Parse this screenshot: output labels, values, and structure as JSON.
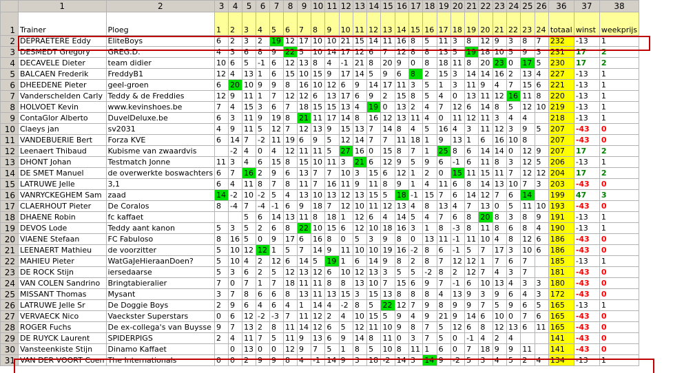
{
  "columns": [
    "1",
    "2",
    "3",
    "4",
    "5",
    "6",
    "7",
    "8",
    "9",
    "10",
    "11",
    "12",
    "13",
    "14",
    "15",
    "16",
    "17",
    "18",
    "19",
    "20",
    "21",
    "22",
    "23",
    "24",
    "25",
    "26",
    "36",
    "37",
    "38"
  ],
  "titles": [
    "Trainer",
    "Ploeg",
    "1",
    "2",
    "3",
    "4",
    "5",
    "6",
    "7",
    "8",
    "9",
    "10",
    "11",
    "12",
    "13",
    "14",
    "15",
    "16",
    "17",
    "18",
    "19",
    "20",
    "21",
    "22",
    "23",
    "24",
    "totaal",
    "winst",
    "weekprijs"
  ],
  "rows": [
    {
      "n": "2",
      "trainer": "DEPRAETERE Eddy",
      "ploeg": "EliteBoys",
      "s": [
        "6",
        "2",
        "3",
        "2",
        "19",
        "12",
        "17",
        "10",
        "10",
        "21",
        "15",
        "14",
        "11",
        "16",
        "8",
        "5",
        "11",
        "3",
        "8",
        "12",
        "9",
        "3",
        "8",
        "7"
      ],
      "hl": [
        4
      ],
      "totaal": "232",
      "winst": "-13",
      "week": "1"
    },
    {
      "n": "3",
      "trainer": "DESMEDT Gregory",
      "ploeg": "GREG.D.",
      "s": [
        "4",
        "3",
        "6",
        "8",
        "9",
        "22",
        "5",
        "10",
        "14",
        "17",
        "12",
        "6",
        "7",
        "12",
        "8",
        "8",
        "13",
        "5",
        "19",
        "18",
        "10",
        "5",
        "9",
        "3"
      ],
      "hl": [
        5,
        18
      ],
      "totaal": "231",
      "winst": "17",
      "week": "2"
    },
    {
      "n": "4",
      "trainer": "DECAVELE Dieter",
      "ploeg": "team didier",
      "s": [
        "10",
        "6",
        "5",
        "-1",
        "6",
        "12",
        "13",
        "8",
        "4",
        "-1",
        "21",
        "8",
        "20",
        "9",
        "0",
        "8",
        "18",
        "11",
        "8",
        "20",
        "23",
        "0",
        "17",
        "5"
      ],
      "hl": [
        20,
        22
      ],
      "totaal": "230",
      "winst": "17",
      "week": "2"
    },
    {
      "n": "5",
      "trainer": "BALCAEN Frederik",
      "ploeg": "FreddyB1",
      "s": [
        "12",
        "4",
        "13",
        "1",
        "6",
        "15",
        "10",
        "15",
        "9",
        "17",
        "14",
        "5",
        "9",
        "6",
        "8",
        "2",
        "15",
        "3",
        "14",
        "14",
        "16",
        "2",
        "13",
        "4"
      ],
      "hl": [
        14
      ],
      "totaal": "227",
      "winst": "-13",
      "week": "1"
    },
    {
      "n": "6",
      "trainer": "DHEEDENE Pieter",
      "ploeg": "geel-groen",
      "s": [
        "6",
        "20",
        "10",
        "9",
        "9",
        "8",
        "16",
        "10",
        "12",
        "6",
        "9",
        "14",
        "17",
        "11",
        "3",
        "5",
        "1",
        "3",
        "11",
        "9",
        "4",
        "7",
        "15",
        "6"
      ],
      "hl": [
        1
      ],
      "totaal": "221",
      "winst": "-13",
      "week": "1"
    },
    {
      "n": "7",
      "trainer": "Vanderschelden Carly",
      "ploeg": "Teddy & de Freddies",
      "s": [
        "12",
        "9",
        "11",
        "1",
        "7",
        "12",
        "12",
        "6",
        "13",
        "17",
        "6",
        "9",
        "2",
        "15",
        "8",
        "5",
        "4",
        "0",
        "13",
        "11",
        "12",
        "16",
        "11",
        "8"
      ],
      "hl": [
        21
      ],
      "totaal": "220",
      "winst": "-13",
      "week": "1"
    },
    {
      "n": "8",
      "trainer": "HOLVOET Kevin",
      "ploeg": "www.kevinshoes.be",
      "s": [
        "7",
        "4",
        "15",
        "3",
        "6",
        "7",
        "18",
        "15",
        "15",
        "13",
        "4",
        "19",
        "0",
        "13",
        "2",
        "4",
        "7",
        "12",
        "6",
        "14",
        "8",
        "5",
        "12",
        "10"
      ],
      "hl": [
        11
      ],
      "totaal": "219",
      "winst": "-13",
      "week": "1"
    },
    {
      "n": "9",
      "trainer": "ContaGlor Alberto",
      "ploeg": "DuvelDeluxe.be",
      "s": [
        "6",
        "3",
        "11",
        "9",
        "19",
        "8",
        "21",
        "11",
        "17",
        "14",
        "8",
        "16",
        "12",
        "13",
        "11",
        "4",
        "0",
        "11",
        "12",
        "11",
        "3",
        "4",
        "4"
      ],
      "hl": [
        6
      ],
      "totaal": "218",
      "winst": "-13",
      "week": "1"
    },
    {
      "n": "10",
      "trainer": "Claeys jan",
      "ploeg": "sv2031",
      "s": [
        "4",
        "9",
        "11",
        "5",
        "12",
        "7",
        "12",
        "13",
        "9",
        "15",
        "13",
        "7",
        "14",
        "8",
        "4",
        "5",
        "16",
        "4",
        "3",
        "11",
        "12",
        "3",
        "9",
        "5"
      ],
      "hl": [],
      "totaal": "207",
      "winst": "-43",
      "week": "0"
    },
    {
      "n": "11",
      "trainer": "VANDEBUERIE Bert",
      "ploeg": "Forza KVE",
      "s": [
        "6",
        "14",
        "7",
        "-2",
        "11",
        "19",
        "6",
        "9",
        "5",
        "12",
        "14",
        "7",
        "7",
        "11",
        "18",
        "1",
        "9",
        "13",
        "1",
        "6",
        "16",
        "10",
        "8"
      ],
      "hl": [],
      "totaal": "207",
      "winst": "-43",
      "week": "0"
    },
    {
      "n": "12",
      "trainer": "Leenaert Thibaud",
      "ploeg": "Kubisme van zwaardvis",
      "s": [
        "",
        "-2",
        "4",
        "0",
        "4",
        "12",
        "11",
        "11",
        "5",
        "27",
        "16",
        "0",
        "15",
        "8",
        "7",
        "1",
        "25",
        "8",
        "6",
        "14",
        "14",
        "0",
        "12",
        "9"
      ],
      "hl": [
        9,
        16
      ],
      "totaal": "207",
      "winst": "17",
      "week": "2"
    },
    {
      "n": "13",
      "trainer": "DHONT Johan",
      "ploeg": "Testmatch Jonne",
      "s": [
        "11",
        "3",
        "4",
        "6",
        "15",
        "8",
        "15",
        "10",
        "11",
        "3",
        "21",
        "6",
        "12",
        "9",
        "5",
        "9",
        "6",
        "-1",
        "6",
        "11",
        "8",
        "3",
        "12",
        "5"
      ],
      "hl": [
        10
      ],
      "totaal": "206",
      "winst": "-13",
      "week": "1"
    },
    {
      "n": "14",
      "trainer": "DE SMET Manuel",
      "ploeg": "de overwerkte boswachters",
      "s": [
        "6",
        "7",
        "16",
        "2",
        "9",
        "6",
        "13",
        "7",
        "7",
        "10",
        "3",
        "15",
        "6",
        "12",
        "1",
        "2",
        "0",
        "15",
        "11",
        "15",
        "11",
        "7",
        "12",
        "12"
      ],
      "hl": [
        2,
        17
      ],
      "totaal": "204",
      "winst": "17",
      "week": "2"
    },
    {
      "n": "15",
      "trainer": "LATRUWE Jelle",
      "ploeg": "3,1",
      "s": [
        "6",
        "4",
        "11",
        "8",
        "7",
        "8",
        "11",
        "7",
        "16",
        "11",
        "9",
        "11",
        "8",
        "9",
        "1",
        "4",
        "11",
        "6",
        "8",
        "14",
        "13",
        "10",
        "7",
        "3"
      ],
      "hl": [],
      "totaal": "203",
      "winst": "-43",
      "week": "0"
    },
    {
      "n": "16",
      "trainer": "VANRYCKEGHEM Sam",
      "ploeg": "zaad",
      "s": [
        "14",
        "-2",
        "10",
        "-2",
        "5",
        "4",
        "13",
        "10",
        "13",
        "12",
        "13",
        "15",
        "5",
        "18",
        "-1",
        "15",
        "7",
        "6",
        "14",
        "12",
        "7",
        "6",
        "14"
      ],
      "hl": [
        0,
        13,
        22
      ],
      "totaal": "199",
      "winst": "47",
      "week": "3"
    },
    {
      "n": "17",
      "trainer": "CLAERHOUT Pieter",
      "ploeg": "De Coralos",
      "s": [
        "8",
        "-4",
        "7",
        "-4",
        "-1",
        "6",
        "9",
        "18",
        "7",
        "12",
        "10",
        "11",
        "12",
        "13",
        "4",
        "8",
        "13",
        "4",
        "7",
        "13",
        "0",
        "5",
        "11",
        "10"
      ],
      "hl": [],
      "totaal": "193",
      "winst": "-43",
      "week": "0"
    },
    {
      "n": "18",
      "trainer": "DHAENE Robin",
      "ploeg": "fc kaffaet",
      "s": [
        "",
        "",
        "5",
        "6",
        "14",
        "13",
        "11",
        "8",
        "18",
        "1",
        "12",
        "6",
        "4",
        "14",
        "5",
        "4",
        "7",
        "6",
        "8",
        "20",
        "8",
        "3",
        "8",
        "9"
      ],
      "hl": [
        19
      ],
      "totaal": "191",
      "winst": "-13",
      "week": "1"
    },
    {
      "n": "19",
      "trainer": "DEVOS Lode",
      "ploeg": "Teddy aant kanon",
      "s": [
        "5",
        "3",
        "5",
        "2",
        "6",
        "8",
        "22",
        "10",
        "15",
        "6",
        "12",
        "10",
        "18",
        "16",
        "3",
        "1",
        "8",
        "-3",
        "8",
        "11",
        "8",
        "6",
        "8",
        "4"
      ],
      "hl": [
        6
      ],
      "totaal": "190",
      "winst": "-13",
      "week": "1"
    },
    {
      "n": "20",
      "trainer": "VIAENE Stefaan",
      "ploeg": "FC Fabuloso",
      "s": [
        "8",
        "16",
        "5",
        "0",
        "9",
        "17",
        "6",
        "16",
        "8",
        "0",
        "5",
        "3",
        "9",
        "8",
        "0",
        "13",
        "11",
        "-1",
        "11",
        "10",
        "4",
        "8",
        "12",
        "6"
      ],
      "hl": [],
      "totaal": "186",
      "winst": "-43",
      "week": "0"
    },
    {
      "n": "21",
      "trainer": "LEENAERT Mathieu",
      "ploeg": "de voorzitter",
      "s": [
        "5",
        "10",
        "12",
        "12",
        "1",
        "5",
        "7",
        "14",
        "9",
        "11",
        "10",
        "10",
        "19",
        "16",
        "-2",
        "8",
        "6",
        "-1",
        "5",
        "7",
        "17",
        "3",
        "10",
        "6"
      ],
      "hl": [
        3
      ],
      "totaal": "186",
      "winst": "-43",
      "week": "0"
    },
    {
      "n": "22",
      "trainer": "MAHIEU Pieter",
      "ploeg": "WatGaJeHieraanDoen?",
      "s": [
        "5",
        "10",
        "4",
        "2",
        "12",
        "6",
        "14",
        "5",
        "19",
        "1",
        "6",
        "14",
        "9",
        "8",
        "2",
        "8",
        "7",
        "12",
        "12",
        "1",
        "7",
        "6",
        "7"
      ],
      "hl": [
        8
      ],
      "totaal": "185",
      "winst": "-13",
      "week": "1"
    },
    {
      "n": "23",
      "trainer": "DE ROCK Stijn",
      "ploeg": "iersedaarse",
      "s": [
        "5",
        "3",
        "6",
        "2",
        "5",
        "12",
        "13",
        "12",
        "6",
        "10",
        "12",
        "13",
        "3",
        "5",
        "5",
        "-2",
        "8",
        "2",
        "12",
        "7",
        "4",
        "3",
        "7"
      ],
      "hl": [],
      "totaal": "181",
      "winst": "-43",
      "week": "0"
    },
    {
      "n": "24",
      "trainer": "VAN COLEN Sandrino",
      "ploeg": "Bringtabieralier",
      "s": [
        "7",
        "0",
        "7",
        "1",
        "7",
        "18",
        "11",
        "11",
        "8",
        "8",
        "13",
        "10",
        "7",
        "15",
        "6",
        "9",
        "7",
        "-1",
        "6",
        "10",
        "13",
        "4",
        "3",
        "3"
      ],
      "hl": [],
      "totaal": "180",
      "winst": "-43",
      "week": "0"
    },
    {
      "n": "25",
      "trainer": "MISSANT Thomas",
      "ploeg": "Mysant",
      "s": [
        "3",
        "7",
        "8",
        "6",
        "6",
        "8",
        "13",
        "11",
        "13",
        "15",
        "3",
        "15",
        "13",
        "8",
        "8",
        "8",
        "4",
        "13",
        "9",
        "3",
        "9",
        "6",
        "4",
        "3"
      ],
      "hl": [],
      "totaal": "172",
      "winst": "-43",
      "week": "0"
    },
    {
      "n": "26",
      "trainer": "LATRUWE Jelle Sr",
      "ploeg": "De Doggie Boys",
      "s": [
        "2",
        "9",
        "6",
        "4",
        "6",
        "4",
        "1",
        "14",
        "4",
        "-2",
        "8",
        "5",
        "22",
        "12",
        "7",
        "9",
        "8",
        "9",
        "9",
        "7",
        "5",
        "9",
        "6",
        "5"
      ],
      "hl": [
        12
      ],
      "totaal": "165",
      "winst": "-13",
      "week": "1"
    },
    {
      "n": "27",
      "trainer": "VERVAECK Nico",
      "ploeg": "Vaeckster Superstars",
      "s": [
        "0",
        "6",
        "12",
        "-2",
        "-3",
        "7",
        "11",
        "12",
        "2",
        "4",
        "10",
        "15",
        "5",
        "9",
        "4",
        "9",
        "21",
        "9",
        "14",
        "6",
        "10",
        "0",
        "7",
        "6"
      ],
      "hl": [],
      "totaal": "165",
      "winst": "-43",
      "week": "0"
    },
    {
      "n": "28",
      "trainer": "ROGER Fuchs",
      "ploeg": "De ex-collega's van Buysse",
      "s": [
        "9",
        "7",
        "13",
        "2",
        "8",
        "11",
        "14",
        "12",
        "6",
        "5",
        "12",
        "11",
        "10",
        "9",
        "8",
        "7",
        "5",
        "12",
        "6",
        "8",
        "12",
        "13",
        "6",
        "11"
      ],
      "hl": [],
      "totaal": "165",
      "winst": "-43",
      "week": "0"
    },
    {
      "n": "29",
      "trainer": "DE RUYCK Laurent",
      "ploeg": "SPIDERPIGS",
      "s": [
        "2",
        "4",
        "11",
        "7",
        "5",
        "11",
        "9",
        "13",
        "6",
        "9",
        "14",
        "8",
        "11",
        "0",
        "3",
        "7",
        "5",
        "0",
        "-1",
        "4",
        "2",
        "4"
      ],
      "hl": [],
      "totaal": "141",
      "winst": "-43",
      "week": "0"
    },
    {
      "n": "30",
      "trainer": "Vansteenkiste Stijn",
      "ploeg": "Dinamo Kaffaet",
      "s": [
        "",
        "0",
        "13",
        "0",
        "0",
        "12",
        "9",
        "7",
        "5",
        "1",
        "8",
        "5",
        "10",
        "8",
        "11",
        "1",
        "6",
        "0",
        "7",
        "18",
        "9",
        "9",
        "11"
      ],
      "hl": [],
      "totaal": "141",
      "winst": "-43",
      "week": "0"
    },
    {
      "n": "31",
      "trainer": "VAN DER VOORT Coen",
      "ploeg": "The Internationals",
      "s": [
        "0",
        "0",
        "2",
        "9",
        "9",
        "8",
        "4",
        "-1",
        "14",
        "9",
        "3",
        "18",
        "-2",
        "14",
        "3",
        "14",
        "9",
        "-2",
        "5",
        "3",
        "4",
        "5",
        "2",
        "4"
      ],
      "hl": [
        15
      ],
      "totaal": "134",
      "winst": "-13",
      "week": "1"
    }
  ]
}
